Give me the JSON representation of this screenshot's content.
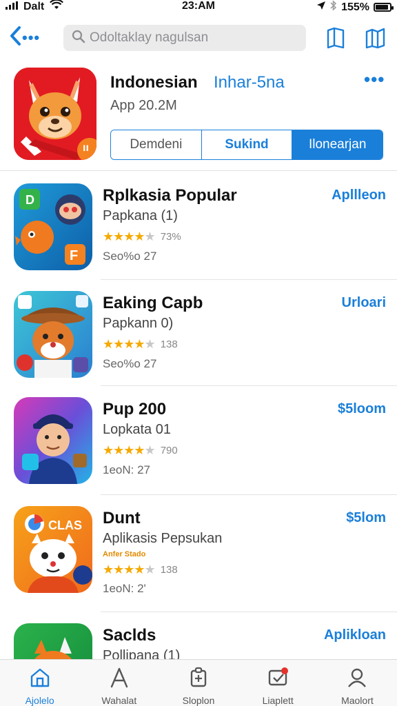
{
  "status_bar": {
    "carrier": "Dalt",
    "time": "23:AM",
    "battery": "155%",
    "battery_level": 0.9
  },
  "nav": {
    "back_dots": "•••",
    "search_placeholder": "Odoltaklay nagulsan"
  },
  "header_app": {
    "title": "Indonesian",
    "subtitle": "Inhar-5na",
    "meta": "App 20.2M",
    "badge": "ıı",
    "more": "•••",
    "segments": [
      {
        "label": "Demdeni",
        "active": false
      },
      {
        "label": "Sukind",
        "active": false
      },
      {
        "label": "Ilonearjan",
        "active": true
      }
    ]
  },
  "apps": [
    {
      "name": "Rplkasia Popular",
      "sub": "Papkana (1)",
      "rating_value": 4,
      "rating_count": "73%",
      "meta": "Seo%o 27",
      "action": "Apllleon",
      "icon": "app-icon-orange-cartoon"
    },
    {
      "name": "Eaking Capb",
      "sub": "Papkann 0)",
      "rating_value": 4,
      "rating_count": "138",
      "meta": "Seo%o 27",
      "action": "Urloari",
      "icon": "app-icon-cowboy-fox"
    },
    {
      "name": "Pup 200",
      "sub": "Lopkata 01",
      "rating_value": 4,
      "rating_count": "790",
      "meta": "1eoN: 27",
      "action": "$5loom",
      "icon": "app-icon-boy-cap"
    },
    {
      "name": "Dunt",
      "sub": "Aplikasis Pepsukan",
      "extra": "Anfer Stado",
      "rating_value": 4,
      "rating_count": "138",
      "meta": "1eoN: 2'",
      "action": "$5lom",
      "icon": "app-icon-clas-fox"
    },
    {
      "name": "Saclds",
      "sub": "Pollipana (1)",
      "action": "Aplikloan",
      "icon": "app-icon-green-fox"
    }
  ],
  "tabs": [
    {
      "label": "Ajolelo",
      "icon": "home-icon",
      "active": true
    },
    {
      "label": "Wahalat",
      "icon": "apps-icon",
      "active": false
    },
    {
      "label": "Sloplon",
      "icon": "games-icon",
      "active": false
    },
    {
      "label": "Liaplett",
      "icon": "updates-icon",
      "active": false
    },
    {
      "label": "Maolort",
      "icon": "person-icon",
      "active": false
    }
  ],
  "colors": {
    "accent": "#1a7fd9",
    "star": "#f5a900",
    "hero_icon_bg": "#e21b22"
  }
}
